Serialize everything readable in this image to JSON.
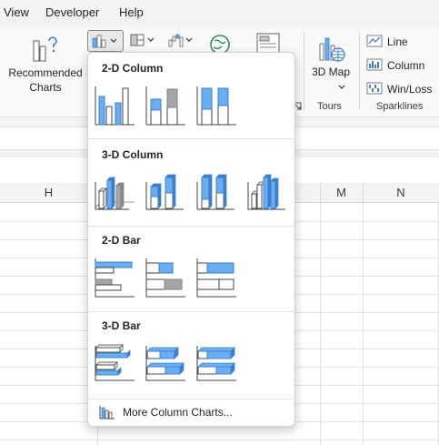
{
  "menubar": {
    "items": [
      "View",
      "Developer",
      "Help"
    ]
  },
  "ribbon": {
    "recommended_charts": "Recommended Charts",
    "map3d": "3D Map",
    "tours": "Tours",
    "sparklines": {
      "group": "Sparklines",
      "items": [
        "Line",
        "Column",
        "Win/Loss"
      ]
    }
  },
  "grid": {
    "columns": [
      "H",
      "M",
      "N"
    ]
  },
  "dropdown": {
    "sections": [
      {
        "title": "2-D Column"
      },
      {
        "title": "3-D Column"
      },
      {
        "title": "2-D Bar"
      },
      {
        "title": "3-D Bar"
      }
    ],
    "more": "More Column Charts..."
  },
  "colors": {
    "accent_blue": "#69aef0",
    "outline_blue": "#3a7fd0",
    "chart_gray": "#a6a6a6"
  }
}
